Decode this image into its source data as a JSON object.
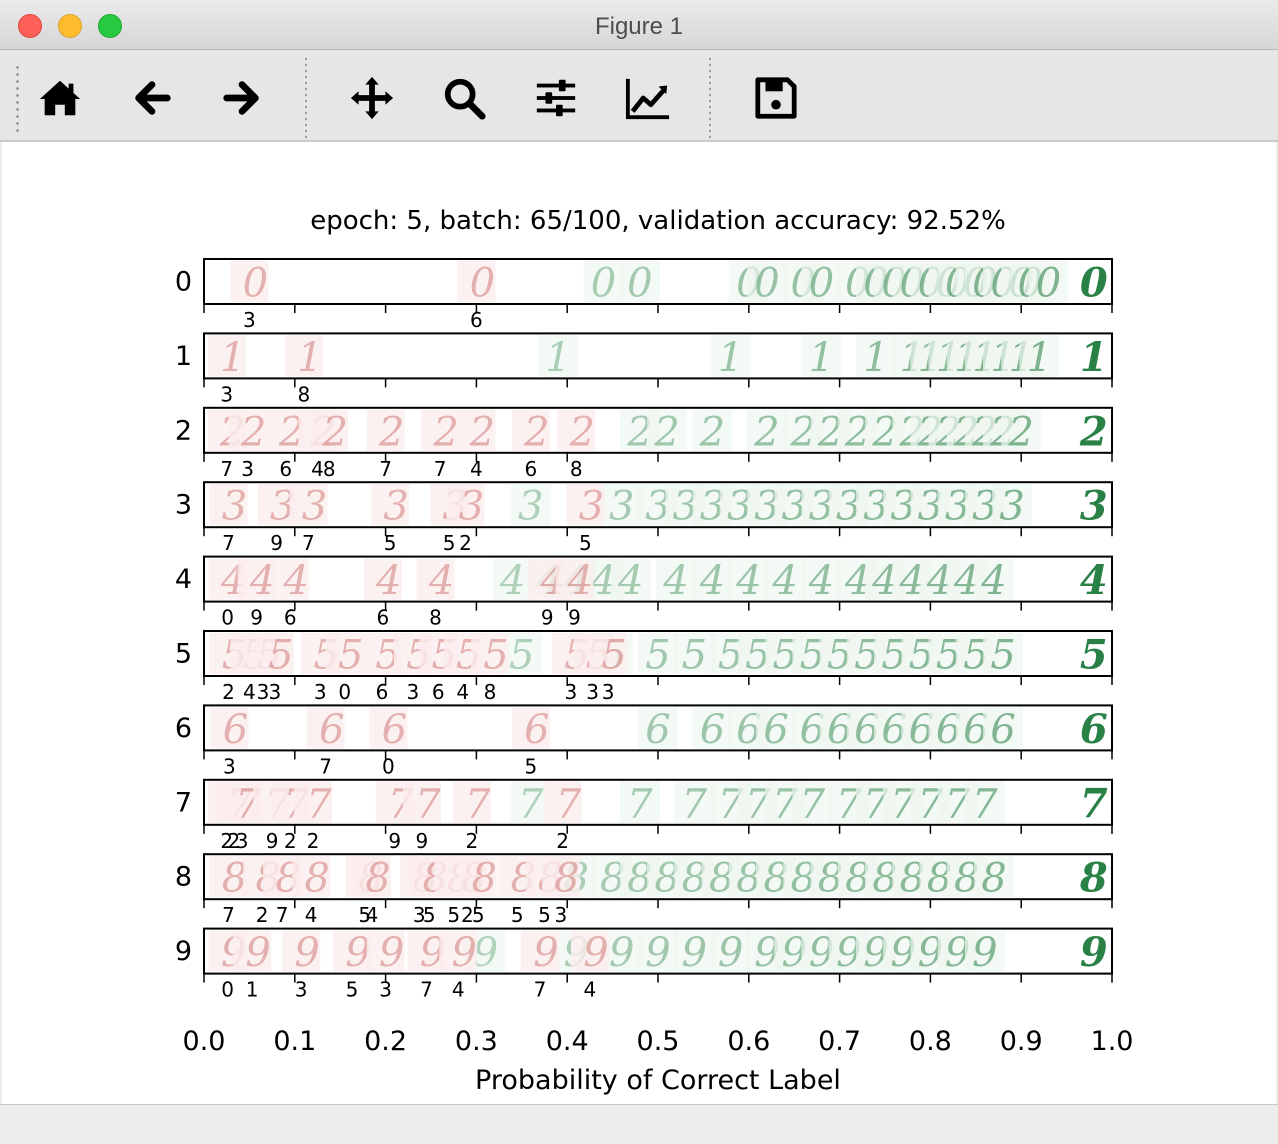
{
  "window": {
    "title": "Figure 1"
  },
  "toolbar": {
    "buttons": [
      {
        "name": "home-button",
        "icon": "home-icon"
      },
      {
        "name": "back-button",
        "icon": "arrow-left-icon"
      },
      {
        "name": "forward-button",
        "icon": "arrow-right-icon"
      },
      {
        "name": "pan-button",
        "icon": "move-icon"
      },
      {
        "name": "zoom-button",
        "icon": "magnifier-icon"
      },
      {
        "name": "subplots-button",
        "icon": "sliders-icon"
      },
      {
        "name": "edit-axes-button",
        "icon": "line-chart-icon"
      },
      {
        "name": "save-button",
        "icon": "floppy-disk-icon"
      }
    ]
  },
  "chart_data": {
    "type": "scatter",
    "title": "epoch: 5, batch: 65/100, validation accuracy: 92.52%",
    "xlabel": "Probability of Correct Label",
    "xlim": [
      0.0,
      1.0
    ],
    "xticks": [
      "0.0",
      "0.1",
      "0.2",
      "0.3",
      "0.4",
      "0.5",
      "0.6",
      "0.7",
      "0.8",
      "0.9",
      "1.0"
    ],
    "grid": false,
    "colors": {
      "incorrect": "#c0504d",
      "correct": "#1e7a3c",
      "axis": "#000000"
    },
    "rows": [
      {
        "label": "0",
        "misclassified": [
          {
            "x": 0.05,
            "pred": "3"
          },
          {
            "x": 0.3,
            "pred": "6"
          }
        ],
        "correct_x": [
          0.44,
          0.48,
          0.6,
          0.62,
          0.66,
          0.68,
          0.72,
          0.74,
          0.76,
          0.78,
          0.8,
          0.82,
          0.83,
          0.85,
          0.86,
          0.88,
          0.9,
          0.91,
          0.93,
          0.98
        ]
      },
      {
        "label": "1",
        "misclassified": [
          {
            "x": 0.025,
            "pred": "3"
          },
          {
            "x": 0.11,
            "pred": "8"
          }
        ],
        "correct_x": [
          0.39,
          0.58,
          0.68,
          0.74,
          0.78,
          0.8,
          0.82,
          0.84,
          0.86,
          0.88,
          0.9,
          0.92,
          0.98
        ]
      },
      {
        "label": "2",
        "misclassified": [
          {
            "x": 0.025,
            "pred": "7"
          },
          {
            "x": 0.048,
            "pred": "3"
          },
          {
            "x": 0.09,
            "pred": "6"
          },
          {
            "x": 0.125,
            "pred": "4"
          },
          {
            "x": 0.138,
            "pred": "8"
          },
          {
            "x": 0.2,
            "pred": "7"
          },
          {
            "x": 0.26,
            "pred": "7"
          },
          {
            "x": 0.3,
            "pred": "4"
          },
          {
            "x": 0.36,
            "pred": "6"
          },
          {
            "x": 0.41,
            "pred": "8"
          }
        ],
        "correct_x": [
          0.48,
          0.51,
          0.56,
          0.62,
          0.66,
          0.69,
          0.72,
          0.75,
          0.78,
          0.8,
          0.82,
          0.84,
          0.86,
          0.88,
          0.9,
          0.98
        ]
      },
      {
        "label": "3",
        "misclassified": [
          {
            "x": 0.027,
            "pred": "7"
          },
          {
            "x": 0.08,
            "pred": "9"
          },
          {
            "x": 0.115,
            "pred": "7"
          },
          {
            "x": 0.205,
            "pred": "5"
          },
          {
            "x": 0.27,
            "pred": "5"
          },
          {
            "x": 0.288,
            "pred": "2"
          },
          {
            "x": 0.42,
            "pred": "5"
          }
        ],
        "correct_x": [
          0.36,
          0.46,
          0.5,
          0.53,
          0.56,
          0.59,
          0.62,
          0.65,
          0.68,
          0.71,
          0.74,
          0.77,
          0.8,
          0.83,
          0.86,
          0.89,
          0.98
        ]
      },
      {
        "label": "4",
        "misclassified": [
          {
            "x": 0.026,
            "pred": "0"
          },
          {
            "x": 0.058,
            "pred": "9"
          },
          {
            "x": 0.095,
            "pred": "6"
          },
          {
            "x": 0.197,
            "pred": "6"
          },
          {
            "x": 0.255,
            "pred": "8"
          },
          {
            "x": 0.378,
            "pred": "9"
          },
          {
            "x": 0.408,
            "pred": "9"
          }
        ],
        "correct_x": [
          0.34,
          0.38,
          0.41,
          0.44,
          0.47,
          0.52,
          0.56,
          0.6,
          0.64,
          0.68,
          0.72,
          0.75,
          0.78,
          0.81,
          0.84,
          0.87,
          0.98
        ]
      },
      {
        "label": "5",
        "misclassified": [
          {
            "x": 0.027,
            "pred": "2"
          },
          {
            "x": 0.05,
            "pred": "4"
          },
          {
            "x": 0.065,
            "pred": "3"
          },
          {
            "x": 0.078,
            "pred": "3"
          },
          {
            "x": 0.128,
            "pred": "3"
          },
          {
            "x": 0.155,
            "pred": "0"
          },
          {
            "x": 0.196,
            "pred": "6"
          },
          {
            "x": 0.23,
            "pred": "3"
          },
          {
            "x": 0.258,
            "pred": "6"
          },
          {
            "x": 0.285,
            "pred": "4"
          },
          {
            "x": 0.315,
            "pred": "8"
          },
          {
            "x": 0.404,
            "pred": "3"
          },
          {
            "x": 0.428,
            "pred": "3"
          },
          {
            "x": 0.445,
            "pred": "3"
          }
        ],
        "correct_x": [
          0.35,
          0.45,
          0.5,
          0.54,
          0.58,
          0.61,
          0.64,
          0.67,
          0.7,
          0.73,
          0.76,
          0.79,
          0.82,
          0.85,
          0.88,
          0.98
        ]
      },
      {
        "label": "6",
        "misclassified": [
          {
            "x": 0.028,
            "pred": "3"
          },
          {
            "x": 0.134,
            "pred": "7"
          },
          {
            "x": 0.203,
            "pred": "0"
          },
          {
            "x": 0.36,
            "pred": "5"
          }
        ],
        "correct_x": [
          0.5,
          0.56,
          0.6,
          0.63,
          0.67,
          0.7,
          0.73,
          0.76,
          0.79,
          0.82,
          0.85,
          0.88,
          0.98
        ]
      },
      {
        "label": "7",
        "misclassified": [
          {
            "x": 0.025,
            "pred": "2"
          },
          {
            "x": 0.033,
            "pred": "2"
          },
          {
            "x": 0.042,
            "pred": "3"
          },
          {
            "x": 0.075,
            "pred": "9"
          },
          {
            "x": 0.095,
            "pred": "2"
          },
          {
            "x": 0.12,
            "pred": "2"
          },
          {
            "x": 0.21,
            "pred": "9"
          },
          {
            "x": 0.24,
            "pred": "9"
          },
          {
            "x": 0.295,
            "pred": "2"
          },
          {
            "x": 0.395,
            "pred": "2"
          }
        ],
        "correct_x": [
          0.36,
          0.48,
          0.54,
          0.58,
          0.61,
          0.64,
          0.67,
          0.71,
          0.74,
          0.77,
          0.8,
          0.83,
          0.86,
          0.98
        ]
      },
      {
        "label": "8",
        "misclassified": [
          {
            "x": 0.027,
            "pred": "7"
          },
          {
            "x": 0.064,
            "pred": "2"
          },
          {
            "x": 0.086,
            "pred": "7"
          },
          {
            "x": 0.118,
            "pred": "4"
          },
          {
            "x": 0.177,
            "pred": "5"
          },
          {
            "x": 0.185,
            "pred": "4"
          },
          {
            "x": 0.237,
            "pred": "3"
          },
          {
            "x": 0.248,
            "pred": "5"
          },
          {
            "x": 0.275,
            "pred": "5"
          },
          {
            "x": 0.29,
            "pred": "2"
          },
          {
            "x": 0.302,
            "pred": "5"
          },
          {
            "x": 0.345,
            "pred": "5"
          },
          {
            "x": 0.375,
            "pred": "5"
          },
          {
            "x": 0.393,
            "pred": "3"
          }
        ],
        "correct_x": [
          0.41,
          0.45,
          0.48,
          0.51,
          0.54,
          0.57,
          0.6,
          0.63,
          0.66,
          0.69,
          0.72,
          0.75,
          0.78,
          0.81,
          0.84,
          0.87,
          0.98
        ]
      },
      {
        "label": "9",
        "misclassified": [
          {
            "x": 0.026,
            "pred": "0"
          },
          {
            "x": 0.053,
            "pred": "1"
          },
          {
            "x": 0.107,
            "pred": "3"
          },
          {
            "x": 0.163,
            "pred": "5"
          },
          {
            "x": 0.2,
            "pred": "3"
          },
          {
            "x": 0.245,
            "pred": "7"
          },
          {
            "x": 0.28,
            "pred": "4"
          },
          {
            "x": 0.37,
            "pred": "7"
          },
          {
            "x": 0.425,
            "pred": "4"
          }
        ],
        "correct_x": [
          0.31,
          0.41,
          0.46,
          0.5,
          0.54,
          0.58,
          0.62,
          0.65,
          0.68,
          0.71,
          0.74,
          0.77,
          0.8,
          0.83,
          0.86,
          0.98
        ]
      }
    ]
  }
}
